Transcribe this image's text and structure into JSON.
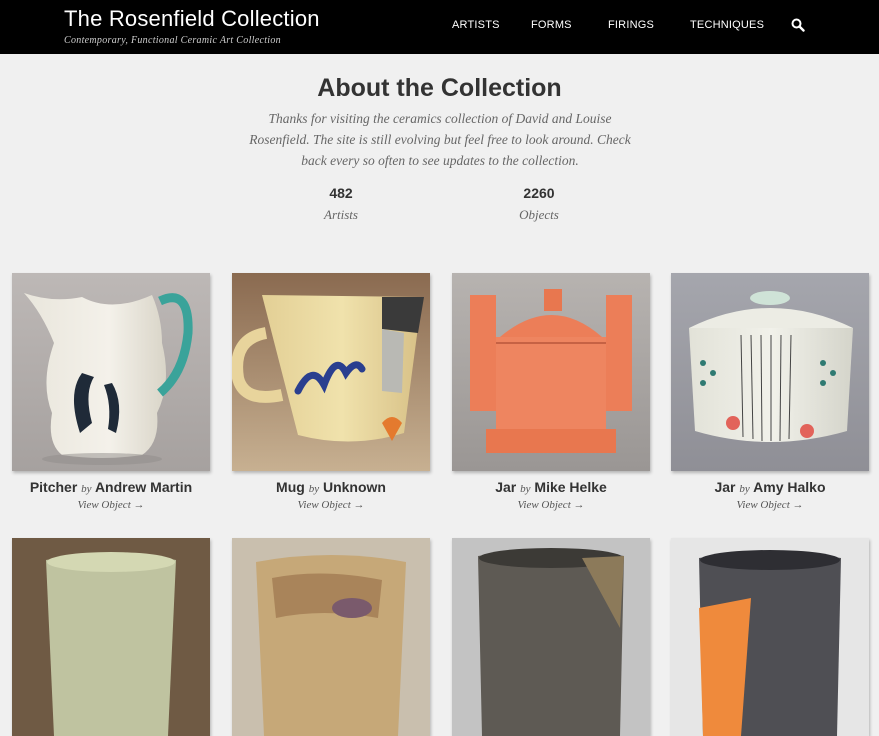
{
  "header": {
    "title": "The Rosenfield Collection",
    "subtitle": "Contemporary, Functional Ceramic Art Collection",
    "nav": [
      "ARTISTS",
      "FORMS",
      "FIRINGS",
      "TECHNIQUES"
    ],
    "search_icon": "search-icon"
  },
  "about": {
    "title": "About the Collection",
    "text": "Thanks for visiting the ceramics collection of David and Louise Rosenfield. The site is still evolving but feel free to look around. Check back every so often to see updates to the collection."
  },
  "stats": [
    {
      "value": "482",
      "label": "Artists"
    },
    {
      "value": "2260",
      "label": "Objects"
    }
  ],
  "objects": [
    {
      "form": "Pitcher",
      "by": "by",
      "artist": "Andrew Martin",
      "link": "View Object →"
    },
    {
      "form": "Mug",
      "by": "by",
      "artist": "Unknown",
      "link": "View Object →"
    },
    {
      "form": "Jar",
      "by": "by",
      "artist": "Mike Helke",
      "link": "View Object →"
    },
    {
      "form": "Jar",
      "by": "by",
      "artist": "Amy Halko",
      "link": "View Object →"
    }
  ],
  "colors": {
    "header_bg": "#000000",
    "page_bg": "#f0f0f0",
    "text": "#333333"
  }
}
